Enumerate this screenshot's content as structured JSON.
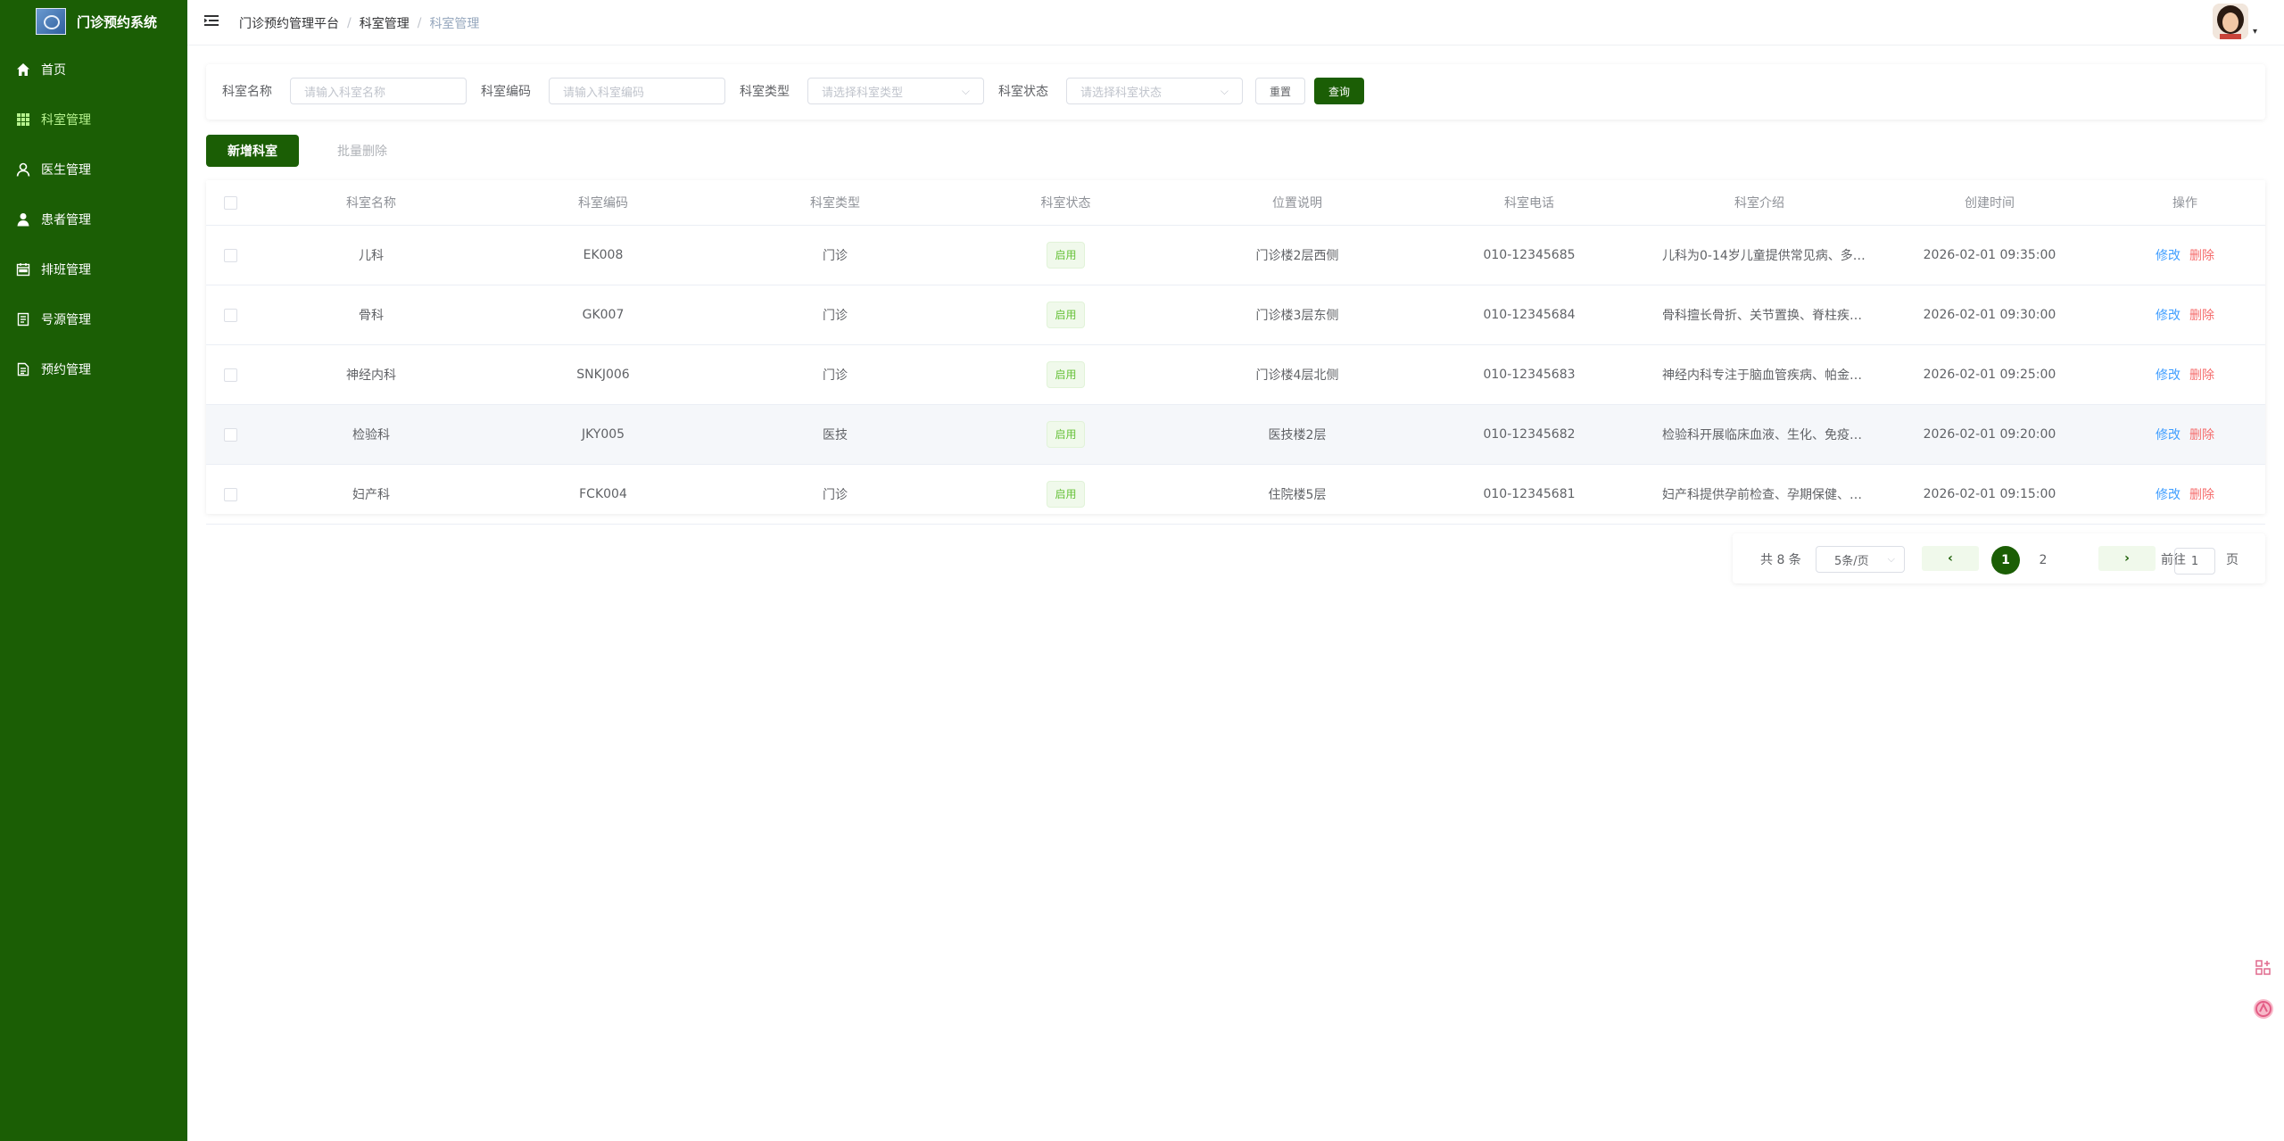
{
  "sidebar": {
    "title": "门诊预约系统",
    "items": [
      {
        "label": "首页",
        "icon": "home-icon"
      },
      {
        "label": "科室管理",
        "icon": "grid-icon",
        "active": true
      },
      {
        "label": "医生管理",
        "icon": "user-outline-icon"
      },
      {
        "label": "患者管理",
        "icon": "user-solid-icon"
      },
      {
        "label": "排班管理",
        "icon": "calendar-icon"
      },
      {
        "label": "号源管理",
        "icon": "document-icon"
      },
      {
        "label": "预约管理",
        "icon": "document-lines-icon"
      }
    ]
  },
  "header": {
    "breadcrumb": [
      "门诊预约管理平台",
      "科室管理",
      "科室管理"
    ]
  },
  "search": {
    "name_label": "科室名称",
    "name_placeholder": "请输入科室名称",
    "code_label": "科室编码",
    "code_placeholder": "请输入科室编码",
    "type_label": "科室类型",
    "type_placeholder": "请选择科室类型",
    "status_label": "科室状态",
    "status_placeholder": "请选择科室状态",
    "reset_label": "重置",
    "query_label": "查询"
  },
  "toolbar": {
    "add_label": "新增科室",
    "batch_delete_label": "批量删除"
  },
  "table": {
    "columns": [
      "科室名称",
      "科室编码",
      "科室类型",
      "科室状态",
      "位置说明",
      "科室电话",
      "科室介绍",
      "创建时间",
      "操作"
    ],
    "rows": [
      {
        "name": "儿科",
        "code": "EK008",
        "type": "门诊",
        "status": "启用",
        "location": "门诊楼2层西侧",
        "phone": "010-12345685",
        "intro": "儿科为0-14岁儿童提供常见病、多…",
        "created": "2026-02-01 09:35:00"
      },
      {
        "name": "骨科",
        "code": "GK007",
        "type": "门诊",
        "status": "启用",
        "location": "门诊楼3层东侧",
        "phone": "010-12345684",
        "intro": "骨科擅长骨折、关节置换、脊柱疾…",
        "created": "2026-02-01 09:30:00"
      },
      {
        "name": "神经内科",
        "code": "SNKJ006",
        "type": "门诊",
        "status": "启用",
        "location": "门诊楼4层北侧",
        "phone": "010-12345683",
        "intro": "神经内科专注于脑血管疾病、帕金…",
        "created": "2026-02-01 09:25:00"
      },
      {
        "name": "检验科",
        "code": "JKY005",
        "type": "医技",
        "status": "启用",
        "location": "医技楼2层",
        "phone": "010-12345682",
        "intro": "检验科开展临床血液、生化、免疫…",
        "created": "2026-02-01 09:20:00"
      },
      {
        "name": "妇产科",
        "code": "FCK004",
        "type": "门诊",
        "status": "启用",
        "location": "住院楼5层",
        "phone": "010-12345681",
        "intro": "妇产科提供孕前检查、孕期保健、…",
        "created": "2026-02-01 09:15:00"
      }
    ],
    "edit_label": "修改",
    "delete_label": "删除"
  },
  "pagination": {
    "total": "共 8 条",
    "page_size": "5条/页",
    "pages": [
      "1",
      "2"
    ],
    "current": "1",
    "goto_label": "前往",
    "goto_value": "1",
    "page_suffix": "页"
  },
  "colors": {
    "primary": "#1b5e05",
    "active_menu": "#b6f28e",
    "edit": "#409eff",
    "delete": "#f56c6c",
    "tag": "#67c23a"
  }
}
